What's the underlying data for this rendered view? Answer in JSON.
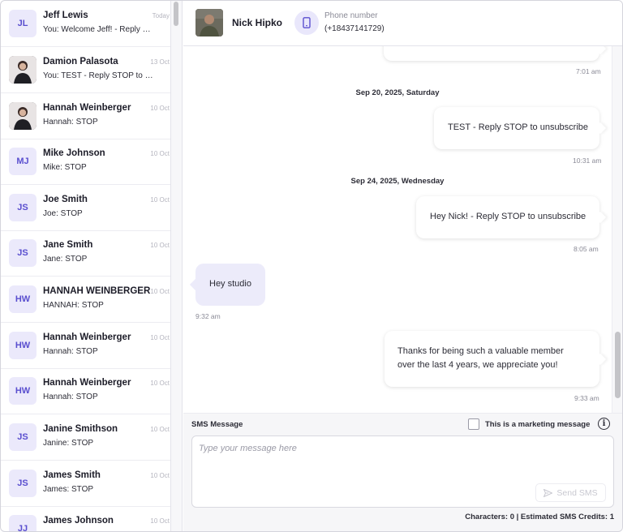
{
  "conversations": [
    {
      "initials": "JL",
      "name": "Jeff Lewis",
      "preview": "You: Welcome Jeff! - Reply …",
      "date": "Today",
      "photo": false
    },
    {
      "initials": "",
      "name": "Damion Palasota",
      "preview": "You: TEST - Reply STOP to …",
      "date": "13 Oct",
      "photo": true
    },
    {
      "initials": "",
      "name": "Hannah Weinberger",
      "preview": "Hannah: STOP",
      "date": "10 Oct",
      "photo": true
    },
    {
      "initials": "MJ",
      "name": "Mike Johnson",
      "preview": "Mike: STOP",
      "date": "10 Oct",
      "photo": false
    },
    {
      "initials": "JS",
      "name": "Joe Smith",
      "preview": "Joe: STOP",
      "date": "10 Oct",
      "photo": false
    },
    {
      "initials": "JS",
      "name": "Jane Smith",
      "preview": "Jane: STOP",
      "date": "10 Oct",
      "photo": false
    },
    {
      "initials": "HW",
      "name": "HANNAH WEINBERGER",
      "preview": "HANNAH: STOP",
      "date": "10 Oct",
      "photo": false
    },
    {
      "initials": "HW",
      "name": "Hannah Weinberger",
      "preview": "Hannah: STOP",
      "date": "10 Oct",
      "photo": false
    },
    {
      "initials": "HW",
      "name": "Hannah Weinberger",
      "preview": "Hannah: STOP",
      "date": "10 Oct",
      "photo": false
    },
    {
      "initials": "JS",
      "name": "Janine Smithson",
      "preview": "Janine: STOP",
      "date": "10 Oct",
      "photo": false
    },
    {
      "initials": "JS",
      "name": "James Smith",
      "preview": "James: STOP",
      "date": "10 Oct",
      "photo": false
    },
    {
      "initials": "JJ",
      "name": "James Johnson",
      "preview": "",
      "date": "10 Oct",
      "photo": false
    }
  ],
  "header": {
    "contact_name": "Nick Hipko",
    "phone_label": "Phone number",
    "phone_value": "(+18437141729)",
    "phone_icon": "phone-icon"
  },
  "thread": {
    "top_time": "7:01 am",
    "day1": "Sep 20, 2025, Saturday",
    "msg1": {
      "text": "TEST - Reply STOP to unsubscribe",
      "time": "10:31 am"
    },
    "day2": "Sep 24, 2025, Wednesday",
    "msg2": {
      "text": "Hey Nick! - Reply STOP to unsubscribe",
      "time": "8:05 am"
    },
    "msg3": {
      "text": "Hey studio",
      "time": "9:32 am"
    },
    "msg4": {
      "line1": "Thanks for being such a valuable member",
      "line2": "over the last 4 years, we appreciate you!",
      "time": "9:33 am"
    }
  },
  "composer": {
    "label": "SMS Message",
    "marketing_label": "This is a marketing message",
    "marketing_checked": false,
    "info_icon": "info-icon",
    "placeholder": "Type your message here",
    "value": "",
    "send_label": "Send SMS",
    "send_icon": "send-icon",
    "footer": "Characters: 0 | Estimated SMS Credits: 1"
  },
  "colors": {
    "accent": "#5a4fcf",
    "avatar_bg": "#ebe9fb",
    "incoming_bubble": "#ecebfa"
  }
}
